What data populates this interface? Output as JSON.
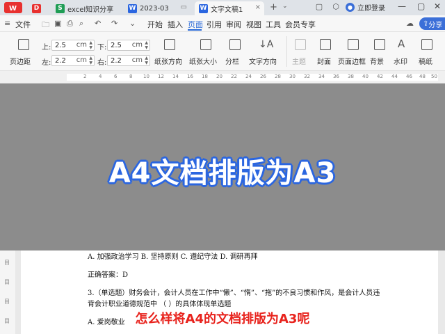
{
  "tabs": [
    {
      "label": "",
      "icon": "wps-logo-icon",
      "color": "#e8312f"
    },
    {
      "label": "",
      "icon": "docer-icon",
      "color": "#e8312f"
    },
    {
      "label": "excel知识分享",
      "icon": "spreadsheet-icon",
      "icon_text": "S",
      "color": "#1f9d55"
    },
    {
      "label": "2023-03",
      "icon": "writer-icon",
      "icon_text": "W",
      "color": "#2b66e0"
    },
    {
      "label": "文字文稿1",
      "icon": "writer-icon",
      "icon_text": "W",
      "color": "#2b66e0"
    }
  ],
  "login_label": "立即登录",
  "share_label": "分享",
  "menu": {
    "file": "文件",
    "items": [
      "开始",
      "插入",
      "页面",
      "引用",
      "审阅",
      "视图",
      "工具",
      "会员专享"
    ],
    "active": "页面"
  },
  "ribbon": {
    "margins_label": "页边距",
    "top_label": "上:",
    "top_value": "2.5",
    "bottom_label": "下:",
    "bottom_value": "2.5",
    "left_label": "左:",
    "left_value": "2.2",
    "right_label": "右:",
    "right_value": "2.2",
    "unit": "cm",
    "buttons": [
      "纸张方向",
      "纸张大小",
      "分栏",
      "文字方向"
    ],
    "theme_label": "主题",
    "buttons2": [
      "封面",
      "页面边框",
      "背景",
      "水印",
      "稿纸"
    ]
  },
  "ruler_numbers": [
    "2",
    "4",
    "6",
    "8",
    "10",
    "12",
    "14",
    "16",
    "18",
    "20",
    "22",
    "24",
    "26",
    "28",
    "30",
    "32",
    "34",
    "36",
    "38",
    "40",
    "42",
    "44",
    "46",
    "48",
    "50"
  ],
  "document": {
    "line1": "A. 加强政治学习   B. 坚持原则   C. 遵纪守法   D. 调研再拜",
    "line2": "正确答案：D",
    "line3": "3.（单选题）财务会计，会计人员在工作中“懒”、“惰”、“拖”的不良习惯和作风，是会计人员违",
    "line4": "背会计职业道德规范中 （    ）的具体体现单选题",
    "line5": "A. 爱岗敬业"
  },
  "overlay_title": "A4文档排版为A3",
  "subtitle": "怎么样将A4的文档排版为A3呢",
  "colors": {
    "accent": "#2b66e0",
    "subtitle": "#e8231d",
    "overlay": "#8c8c8c"
  }
}
